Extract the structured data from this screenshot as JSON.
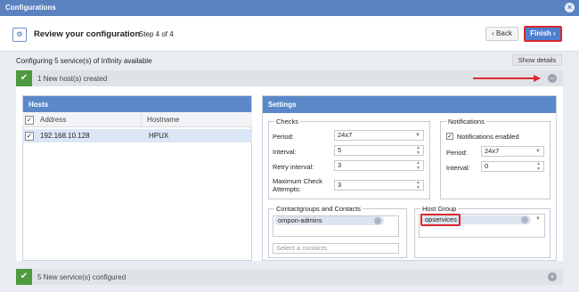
{
  "window": {
    "title": "Configurations"
  },
  "header": {
    "title": "Review your configuration",
    "step": "Step 4 of 4",
    "back_label": "Back",
    "finish_label": "Finish"
  },
  "summary": {
    "configuring": "Configuring  5 service(s) of Infinity available",
    "show_details": "Show details"
  },
  "sections": {
    "hosts_created": "1 New host(s) created",
    "services_configured": "5 New service(s) configured"
  },
  "hosts": {
    "panel_title": "Hosts",
    "columns": [
      "Address",
      "Hostname"
    ],
    "rows": [
      {
        "address": "192.168.10.128",
        "hostname": "HPUX"
      }
    ]
  },
  "settings": {
    "panel_title": "Settings",
    "checks": {
      "legend": "Checks",
      "period_label": "Period:",
      "period_value": "24x7",
      "interval_label": "Interval:",
      "interval_value": "5",
      "retry_label": "Retry interval:",
      "retry_value": "3",
      "max_label": "Maximum Check Attempts:",
      "max_value": "3"
    },
    "notifications": {
      "legend": "Notifications",
      "enabled_label": "Notifications enabled",
      "period_label": "Period:",
      "period_value": "24x7",
      "interval_label": "Interval:",
      "interval_value": "0"
    },
    "contacts": {
      "legend": "Contactgroups and Contacts",
      "group_tag": "ompon-admins",
      "placeholder": "Select a contacts"
    },
    "hostgroup": {
      "legend": "Host Group",
      "tag": "opservices"
    }
  },
  "colors": {
    "titlebar": "#5a82bf",
    "panel_header": "#5b88c9",
    "success": "#4d9a3f",
    "highlight": "#d9262c"
  }
}
